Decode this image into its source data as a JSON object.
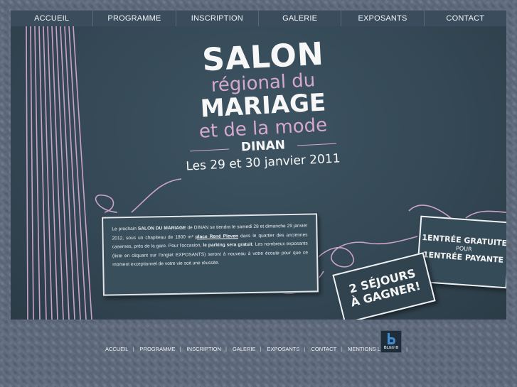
{
  "nav": [
    "ACCUEIL",
    "PROGRAMME",
    "INSCRIPTION",
    "GALERIE",
    "EXPOSANTS",
    "CONTACT"
  ],
  "title": {
    "salon": "SALON",
    "regional": "régional du",
    "mariage": "MARIAGE",
    "mode": "et de la mode",
    "city": "DINAN",
    "dates": "Les 29 et 30 janvier 2011"
  },
  "info": {
    "t1": "Le prochain ",
    "b1": "SALON DU MARIAGE",
    "t2": " de DINAN se tiendra le samedi 28 et dimanche 29 janvier 2012, sous un chapiteau de 1800 m² ",
    "link": "place René Pleven",
    "t3": " dans le quartier des anciennes casernes, près de la gare. Pour l'occasion, ",
    "b2": "le parking sera gratuit",
    "t4": ". Les nombreux exposants (liste en cliquant sur l'onglet EXPOSANTS) seront à nouveau à votre écoute pour que ce moment exceptionnel de votre vie soit une réussite."
  },
  "tag1": {
    "l1": "1ENTRÉE GRATUITE",
    "l2": "POUR",
    "l3": "1ENTRÉE PAYANTE"
  },
  "tag2": {
    "l1": "2 SÉJOURS",
    "l2": "À GAGNER!"
  },
  "footer": [
    "ACCUEIL",
    "PROGRAMME",
    "INSCRIPTION",
    "GALERIE",
    "EXPOSANTS",
    "CONTACT",
    "MENTIONS LÉGALES"
  ],
  "logo": {
    "text": "BLEU B",
    "icon": "bleu-b-logo-icon"
  },
  "colors": {
    "nav_bg": "#3b4d5d",
    "banner_bg": "#344855",
    "accent_pink": "#d4a8cf",
    "page_bg": "#5e6a7c"
  }
}
